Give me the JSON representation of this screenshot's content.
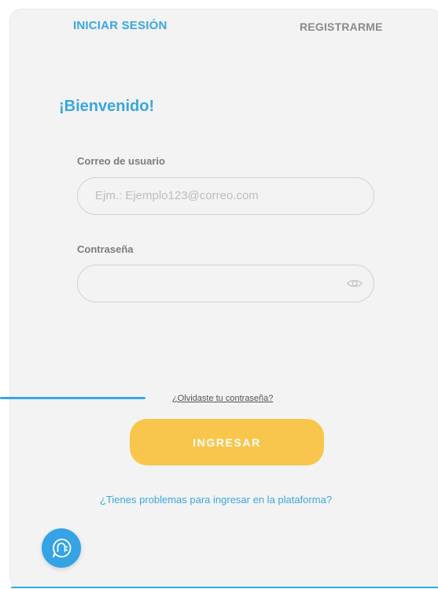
{
  "tabs": {
    "login": "INICIAR SESIÓN",
    "register": "REGISTRARME"
  },
  "title": "¡Bienvenido!",
  "email": {
    "label": "Correo de usuario",
    "placeholder": "Ejm.: Ejemplo123@correo.com",
    "value": ""
  },
  "password": {
    "label": "Contraseña",
    "value": "",
    "toggle_icon": "eye-icon"
  },
  "forgot_link": "¿Olvidaste tu contraseña?",
  "submit_button": "INGRESAR",
  "help_link": "¿Tienes problemas para ingresar en la plataforma?",
  "chat_icon": "chat-bubble-icon",
  "colors": {
    "accent": "#3aa6e4",
    "button": "#f8c64c",
    "card_bg": "#f3f3f3"
  }
}
